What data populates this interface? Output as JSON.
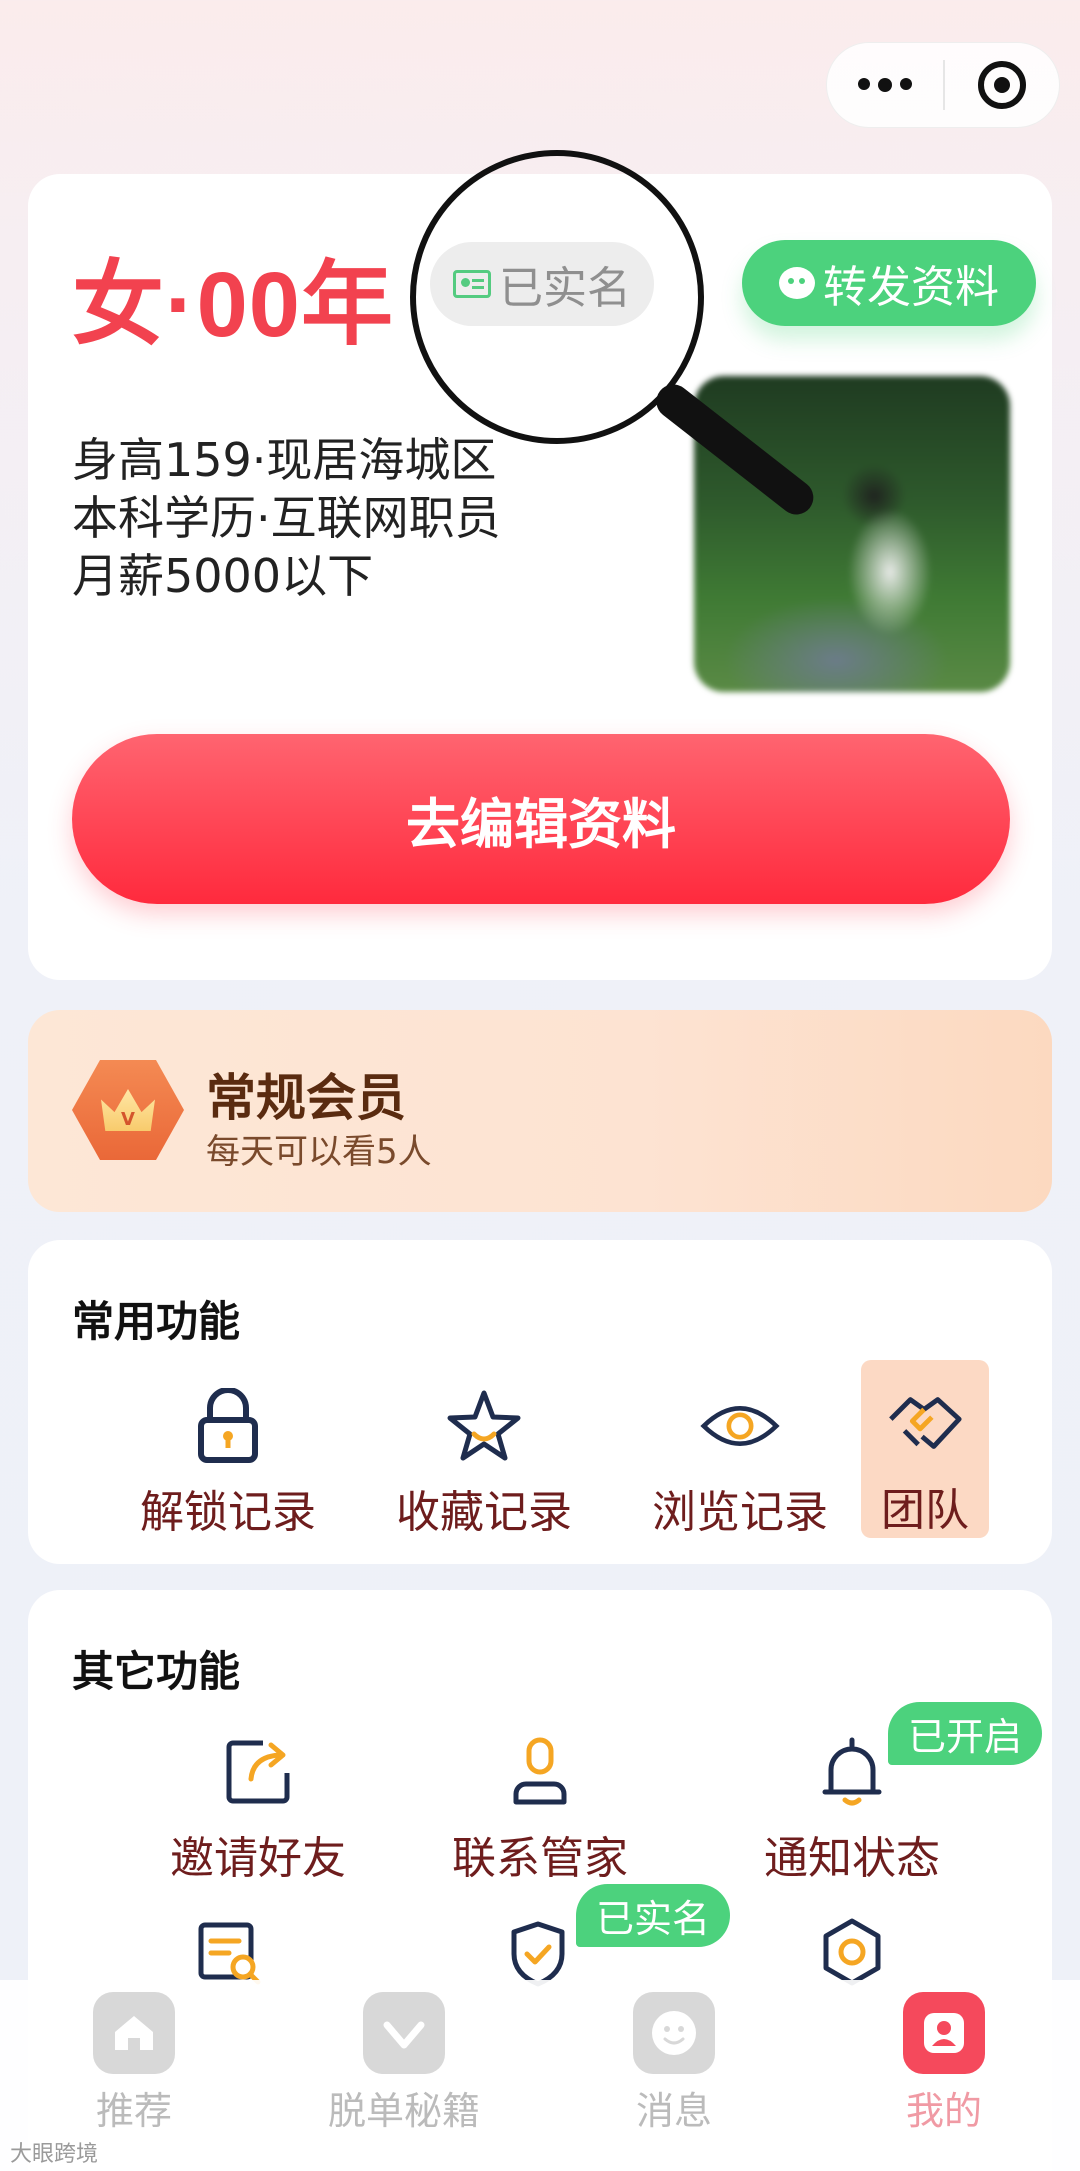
{
  "profile": {
    "headline": "女·00年",
    "verify_chip": "已实名",
    "share_button": "转发资料",
    "info_lines": [
      "身高159·现居海城区",
      "本科学历·互联网职员",
      "月薪5000以下"
    ],
    "edit_button": "去编辑资料"
  },
  "vip": {
    "title": "常规会员",
    "subtitle": "每天可以看5人",
    "badge_letter": "V"
  },
  "common_functions": {
    "title": "常用功能",
    "items": [
      {
        "label": "解锁记录",
        "icon": "lock-icon"
      },
      {
        "label": "收藏记录",
        "icon": "star-icon"
      },
      {
        "label": "浏览记录",
        "icon": "eye-icon"
      },
      {
        "label": "团队",
        "icon": "handshake-icon"
      }
    ]
  },
  "other_functions": {
    "title": "其它功能",
    "items": [
      {
        "label": "邀请好友",
        "icon": "share-icon"
      },
      {
        "label": "联系管家",
        "icon": "person-icon"
      },
      {
        "label": "通知状态",
        "icon": "bell-icon",
        "tag": "已开启"
      }
    ],
    "second_row_tag": "已实名"
  },
  "tabbar": {
    "items": [
      {
        "label": "推荐",
        "icon": "home-icon"
      },
      {
        "label": "脱单秘籍",
        "icon": "heart-icon"
      },
      {
        "label": "消息",
        "icon": "smile-icon"
      },
      {
        "label": "我的",
        "icon": "user-icon",
        "active": true
      }
    ]
  },
  "watermark": "大眼跨境",
  "colors": {
    "accent_red": "#f2424f",
    "green": "#4cd27d",
    "icon_navy": "#1f2d4e",
    "icon_orange": "#f5a623"
  }
}
